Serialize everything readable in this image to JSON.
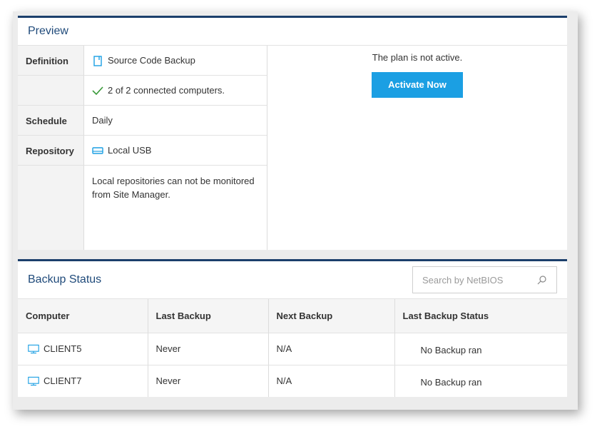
{
  "preview": {
    "title": "Preview",
    "definition_label": "Definition",
    "definition_value": "Source Code Backup",
    "computers_value": "2 of 2 connected computers.",
    "schedule_label": "Schedule",
    "schedule_value": "Daily",
    "repository_label": "Repository",
    "repository_value": "Local USB",
    "repository_note": "Local repositories can not be monitored from Site Manager.",
    "inactive_text": "The plan is not active.",
    "activate_label": "Activate Now"
  },
  "backup_status": {
    "title": "Backup Status",
    "search_placeholder": "Search by NetBIOS",
    "columns": [
      "Computer",
      "Last Backup",
      "Next Backup",
      "Last Backup Status"
    ],
    "rows": [
      {
        "computer": "CLIENT5",
        "last_backup": "Never",
        "next_backup": "N/A",
        "status": "No Backup ran"
      },
      {
        "computer": "CLIENT7",
        "last_backup": "Never",
        "next_backup": "N/A",
        "status": "No Backup ran"
      }
    ]
  },
  "colors": {
    "accent": "#1b9fe3",
    "header_border": "#1b3f6b",
    "title": "#1f4a7a",
    "check": "#3a9a3a"
  },
  "icons": {
    "definition": "document-icon",
    "computers": "checkmark-icon",
    "repository": "usb-drive-icon",
    "computer_row": "monitor-icon",
    "search": "search-icon"
  }
}
